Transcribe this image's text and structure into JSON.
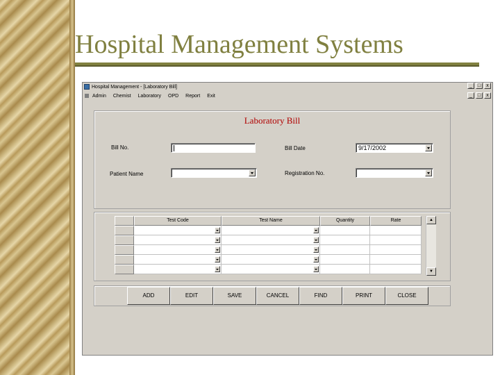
{
  "slide": {
    "title": "Hospital Management Systems"
  },
  "window": {
    "title": "Hospital Management - [Laboratory Bill]",
    "buttons": [
      "_",
      "□",
      "x"
    ]
  },
  "menu": [
    "Admin",
    "Chemist",
    "Laboratory",
    "OPD",
    "Report",
    "Exit"
  ],
  "form": {
    "heading": "Laboratory Bill",
    "bill_no_label": "Bill No.",
    "bill_no_value": "",
    "bill_date_label": "Bill Date",
    "bill_date_value": "9/17/2002",
    "patient_name_label": "Patient Name",
    "patient_name_value": "",
    "registration_label": "Registration No.",
    "registration_value": ""
  },
  "grid": {
    "headers": [
      "Test Code",
      "Test Name",
      "Quantity",
      "Rate"
    ],
    "scroll_up": "▲",
    "scroll_down": "▼"
  },
  "actions": {
    "add": "ADD",
    "edit": "EDIT",
    "save": "SAVE",
    "cancel": "CANCEL",
    "find": "FIND",
    "print": "PRINT",
    "close": "CLOSE"
  }
}
